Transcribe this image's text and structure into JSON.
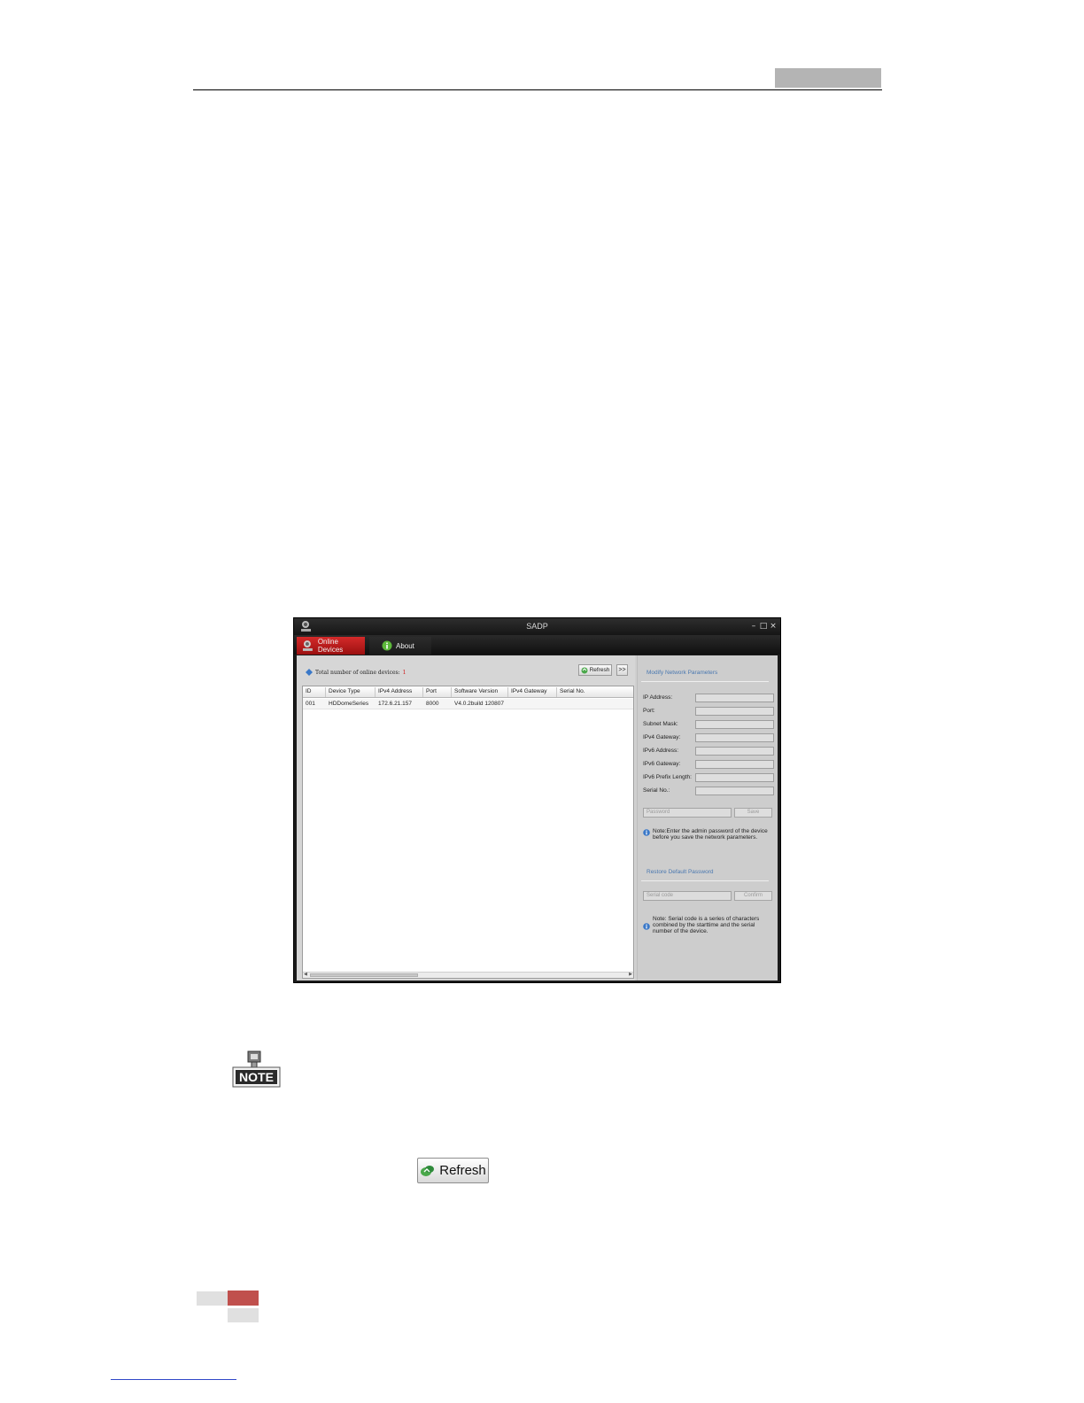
{
  "window": {
    "title": "SADP"
  },
  "tabs": [
    {
      "label": "Online Devices",
      "active": true
    },
    {
      "label": "About",
      "active": false
    }
  ],
  "device_list": {
    "count_label": "Total number of online devices:",
    "count_value": "1",
    "refresh_label": "Refresh",
    "expand_label": ">>",
    "columns": [
      "ID",
      "Device Type",
      "IPv4 Address",
      "Port",
      "Software Version",
      "IPv4 Gateway",
      "Serial No."
    ],
    "rows": [
      [
        "001",
        "HDDomeSeries",
        "172.6.21.157",
        "8000",
        "V4.0.2build 120807",
        "",
        ""
      ]
    ]
  },
  "modify_panel": {
    "title": "Modify Network Parameters",
    "fields": [
      "IP Address:",
      "Port:",
      "Subnet Mask:",
      "IPv4 Gateway:",
      "IPv6 Address:",
      "IPv6 Gateway:",
      "IPv6 Prefix Length:",
      "Serial No.:"
    ],
    "password_placeholder": "Password",
    "save_label": "Save",
    "note": "Note:Enter the admin password of the device\nbefore you save the network parameters."
  },
  "restore_panel": {
    "title": "Restore Default Password",
    "serial_placeholder": "Serial code",
    "confirm_label": "Confirm",
    "note": "Note: Serial code is a series of characters\ncombined by the starttime and the serial\nnumber of the device."
  },
  "note_badge": {
    "label": "NOTE"
  },
  "inline_button": {
    "label": "Refresh"
  },
  "colors": {
    "accent_red": "#c01818",
    "header_gray": "#b4b4b4",
    "footer_red": "#c0504d",
    "link_blue": "#3048c8"
  }
}
